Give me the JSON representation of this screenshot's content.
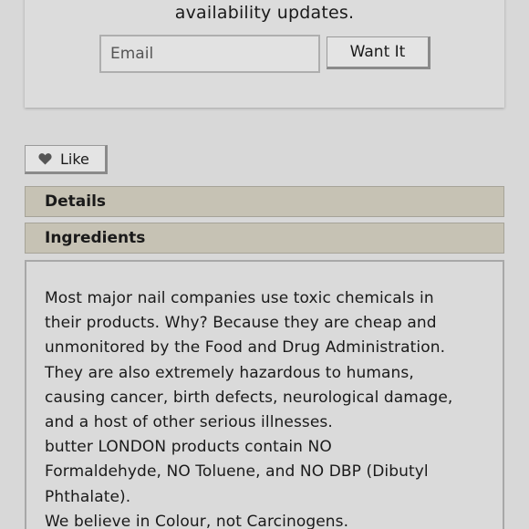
{
  "notify": {
    "text": "availability updates.",
    "email_placeholder": "Email",
    "button_label": "Want It"
  },
  "like": {
    "label": "Like",
    "icon": "heart-icon"
  },
  "accordion": {
    "details_label": "Details",
    "ingredients_label": "Ingredients"
  },
  "ingredients_panel": {
    "lines": [
      "Most major nail companies use toxic chemicals in",
      "their products. Why? Because they are cheap and",
      "unmonitored by the Food and Drug Administration.",
      "They are also extremely hazardous to humans,",
      "causing cancer, birth defects, neurological damage,",
      "and a host of other serious illnesses.",
      "butter LONDON products contain NO",
      "Formaldehyde, NO Toluene, and NO DBP (Dibutyl",
      "Phthalate).",
      "We believe in Colour, not Carcinogens."
    ]
  },
  "colors": {
    "background": "#d8d8d8",
    "accordion_header": "#c6c2b4",
    "heart": "#555555"
  }
}
